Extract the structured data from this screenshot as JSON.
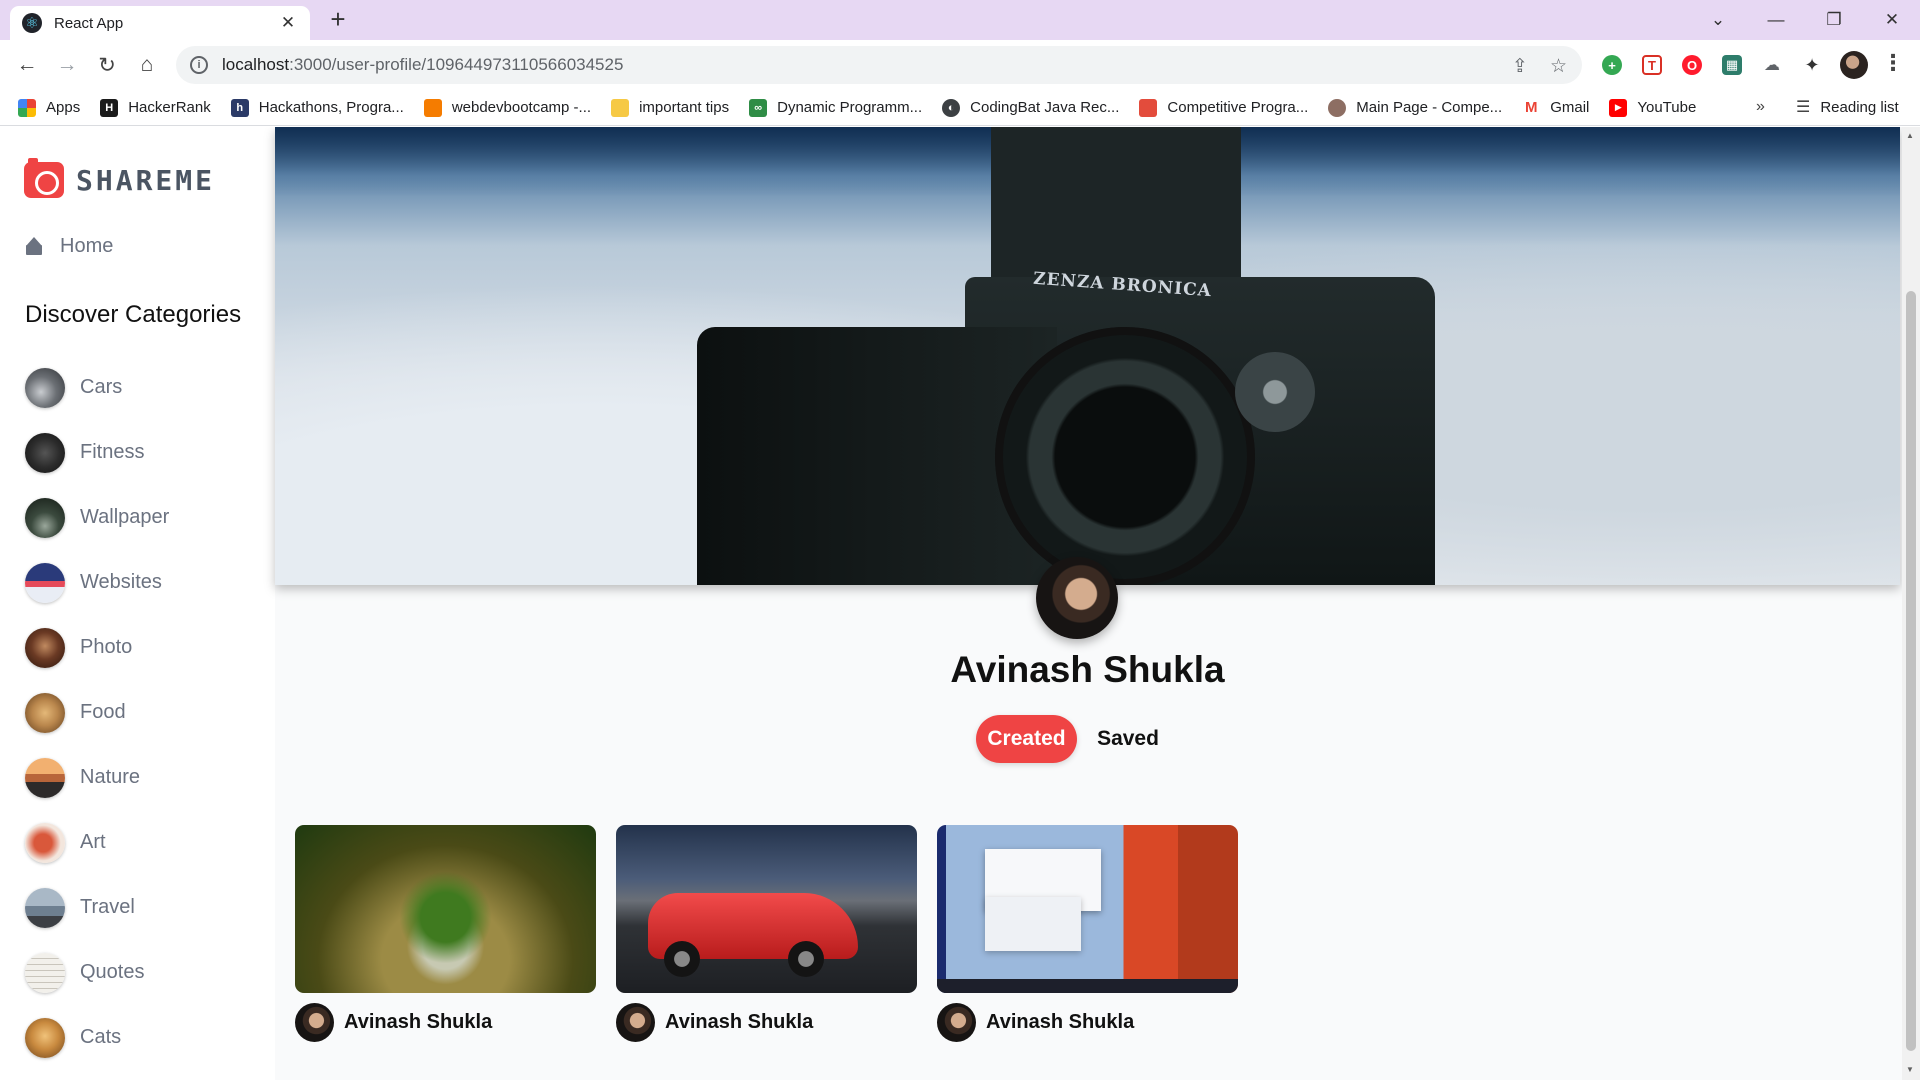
{
  "browser": {
    "tab_title": "React App",
    "tab_favicon": "⚛",
    "url_host": "localhost",
    "url_path": ":3000/user-profile/109644973110566034525",
    "bookmarks": [
      {
        "label": "Apps",
        "icon": "apps-grid",
        "color": "#4285f4"
      },
      {
        "label": "HackerRank",
        "icon": "hackerrank",
        "color": "#1b1b1b"
      },
      {
        "label": "Hackathons, Progra...",
        "icon": "hackerearth",
        "color": "#2b3a67"
      },
      {
        "label": "webdevbootcamp -...",
        "icon": "cube",
        "color": "#f57c00"
      },
      {
        "label": "important tips",
        "icon": "folder",
        "color": "#f6c945"
      },
      {
        "label": "Dynamic Programm...",
        "icon": "gfg",
        "color": "#2f8d46"
      },
      {
        "label": "CodingBat Java Rec...",
        "icon": "globe",
        "color": "#3c4043"
      },
      {
        "label": "Competitive Progra...",
        "icon": "box",
        "color": "#e34c3c"
      },
      {
        "label": "Main Page - Compe...",
        "icon": "user-circle",
        "color": "#8d6e63"
      },
      {
        "label": "Gmail",
        "icon": "gmail",
        "color": "#ea4335"
      },
      {
        "label": "YouTube",
        "icon": "youtube",
        "color": "#ff0000"
      }
    ],
    "more_label": "»",
    "reading_list": "Reading list"
  },
  "sidebar": {
    "logo_text": "SHAREME",
    "home_label": "Home",
    "categories_heading": "Discover Categories",
    "categories": [
      {
        "label": "Cars",
        "color": "#6b6f74"
      },
      {
        "label": "Fitness",
        "color": "#2c2c2c"
      },
      {
        "label": "Wallpaper",
        "color": "#3b4a3e"
      },
      {
        "label": "Websites",
        "color": "#2a3a7a"
      },
      {
        "label": "Photo",
        "color": "#6b3a24"
      },
      {
        "label": "Food",
        "color": "#b9864c"
      },
      {
        "label": "Nature",
        "color": "#b8653a"
      },
      {
        "label": "Art",
        "color": "#d9583b"
      },
      {
        "label": "Travel",
        "color": "#6e7f90"
      },
      {
        "label": "Quotes",
        "color": "#e7e4dd"
      },
      {
        "label": "Cats",
        "color": "#c98a3f"
      }
    ]
  },
  "profile": {
    "banner_brand": "ZENZA BRONICA",
    "name": "Avinash Shukla",
    "tabs": {
      "created": "Created",
      "saved": "Saved"
    },
    "pins": [
      {
        "author": "Avinash Shukla",
        "image": "tree-in-glass-sphere"
      },
      {
        "author": "Avinash Shukla",
        "image": "red-sports-car"
      },
      {
        "author": "Avinash Shukla",
        "image": "windows-desktop"
      }
    ]
  },
  "colors": {
    "accent": "#ef4444",
    "titlebar": "#e7d8f3",
    "text_muted": "#6b7280"
  }
}
